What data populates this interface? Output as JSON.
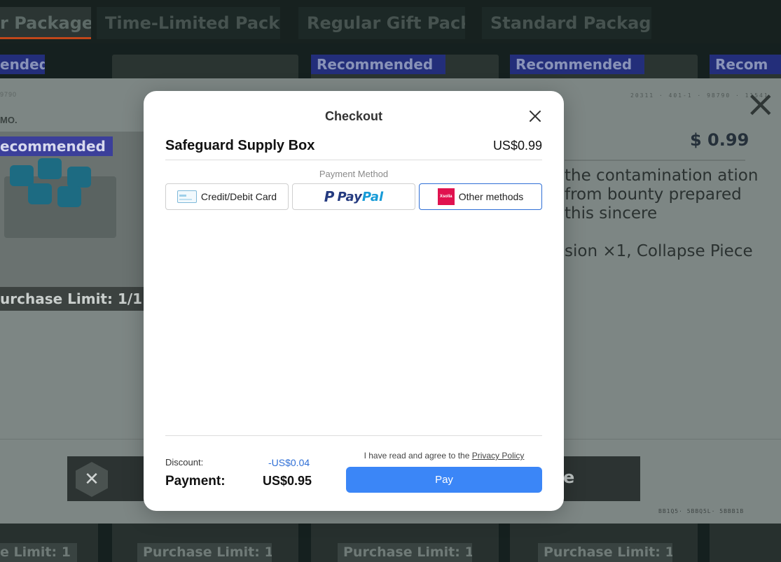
{
  "tabs": [
    {
      "label": "r Package",
      "active": true
    },
    {
      "label": "Time-Limited Package",
      "active": false
    },
    {
      "label": "Regular Gift Pack",
      "active": false
    },
    {
      "label": "Standard Package",
      "active": false
    }
  ],
  "card_badges": [
    "ended",
    "Recommended",
    "Recommended",
    "Recom"
  ],
  "card_limits": [
    "e Limit: 1",
    "Purchase Limit: 1",
    "Purchase Limit: 1",
    "Purchase Limit: 1"
  ],
  "product_panel": {
    "serial_left": "9790",
    "serial_right": "20311 · 401-1 · 98790 · 11541",
    "mo_label": "MO.",
    "recommended": "ecommended",
    "price": "$ 0.99",
    "description": "the contamination ation from bounty prepared this sincere",
    "contents": "sion ×1, Collapse Piece",
    "purchase_limit": "urchase Limit: 1/1",
    "cancel_icon": "close-icon",
    "buy_partial": "e",
    "serial_bottom": "BB1Q5· 5BBQ5L· 5BBB1B"
  },
  "checkout": {
    "title": "Checkout",
    "product_name": "Safeguard Supply Box",
    "product_price": "US$0.99",
    "payment_method_label": "Payment Method",
    "methods": [
      {
        "label": "Credit/Debit Card",
        "icon": "credit-card-icon",
        "selected": false
      },
      {
        "label": "PayPal",
        "icon": "paypal-logo",
        "selected": false
      },
      {
        "label": "Other methods",
        "icon": "xsolla-icon",
        "selected": true
      }
    ],
    "xsolla_icon_text": "Xsolla",
    "paypal_pay": "Pay",
    "paypal_pal": "Pal",
    "discount_label": "Discount:",
    "discount_value": "-US$0.04",
    "payment_label": "Payment:",
    "payment_value": "US$0.95",
    "agree_text": "I have read and agree to the ",
    "privacy_link": "Privacy Policy",
    "pay_button": "Pay",
    "accent_color": "#3b86f7",
    "selected_border_color": "#2f6fd6"
  }
}
